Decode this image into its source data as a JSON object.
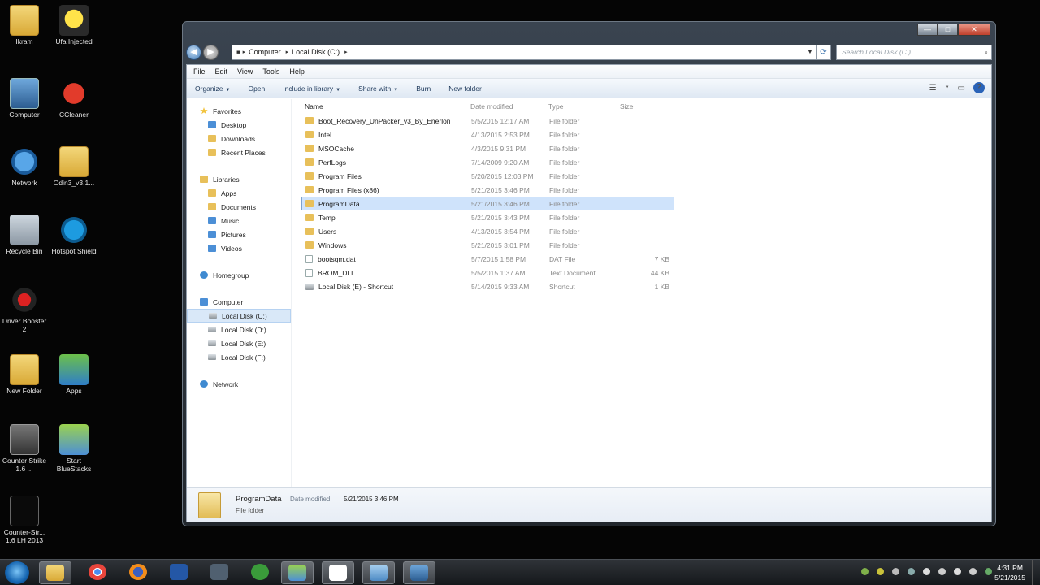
{
  "desktop_icons": [
    {
      "label": "Ikram",
      "x": 0,
      "y": 0
    },
    {
      "label": "Ufa Injected"
    },
    {
      "label": "Computer"
    },
    {
      "label": "CCleaner"
    },
    {
      "label": "Network"
    },
    {
      "label": "Odin3_v3.1..."
    },
    {
      "label": "Recycle Bin"
    },
    {
      "label": "Hotspot Shield"
    },
    {
      "label": "Driver Booster 2"
    },
    {
      "label": "New Folder"
    },
    {
      "label": "Apps"
    },
    {
      "label": "Counter Strike 1.6 ..."
    },
    {
      "label": "Start BlueStacks"
    },
    {
      "label": "Counter-Str... 1.6 LH 2013"
    }
  ],
  "window": {
    "controls": {
      "minimize": "—",
      "maximize": "□",
      "close": "✕"
    },
    "nav": {
      "back": "◀",
      "forward": "▶"
    },
    "breadcrumb": [
      "Computer",
      "Local Disk (C:)"
    ],
    "search_placeholder": "Search Local Disk (C:)",
    "menu": [
      "File",
      "Edit",
      "View",
      "Tools",
      "Help"
    ],
    "toolbar": {
      "organize": "Organize",
      "open": "Open",
      "include": "Include in library",
      "share": "Share with",
      "burn": "Burn",
      "new_folder": "New folder",
      "help": "?"
    },
    "nav_pane": {
      "favorites": "Favorites",
      "fav_items": [
        "Desktop",
        "Downloads",
        "Recent Places"
      ],
      "libraries": "Libraries",
      "lib_items": [
        "Apps",
        "Documents",
        "Music",
        "Pictures",
        "Videos"
      ],
      "homegroup": "Homegroup",
      "computer": "Computer",
      "drives": [
        "Local Disk (C:)",
        "Local Disk (D:)",
        "Local Disk (E:)",
        "Local Disk (F:)"
      ],
      "network": "Network"
    },
    "columns": {
      "name": "Name",
      "date": "Date modified",
      "type": "Type",
      "size": "Size"
    },
    "files": [
      {
        "name": "Boot_Recovery_UnPacker_v3_By_Enerlon",
        "date": "5/5/2015 12:17 AM",
        "type": "File folder",
        "size": ""
      },
      {
        "name": "Intel",
        "date": "4/13/2015 2:53 PM",
        "type": "File folder",
        "size": ""
      },
      {
        "name": "MSOCache",
        "date": "4/3/2015 9:31 PM",
        "type": "File folder",
        "size": ""
      },
      {
        "name": "PerfLogs",
        "date": "7/14/2009 9:20 AM",
        "type": "File folder",
        "size": ""
      },
      {
        "name": "Program Files",
        "date": "5/20/2015 12:03 PM",
        "type": "File folder",
        "size": ""
      },
      {
        "name": "Program Files (x86)",
        "date": "5/21/2015 3:46 PM",
        "type": "File folder",
        "size": ""
      },
      {
        "name": "ProgramData",
        "date": "5/21/2015 3:46 PM",
        "type": "File folder",
        "size": ""
      },
      {
        "name": "Temp",
        "date": "5/21/2015 3:43 PM",
        "type": "File folder",
        "size": ""
      },
      {
        "name": "Users",
        "date": "4/13/2015 3:54 PM",
        "type": "File folder",
        "size": ""
      },
      {
        "name": "Windows",
        "date": "5/21/2015 3:01 PM",
        "type": "File folder",
        "size": ""
      },
      {
        "name": "bootsqm.dat",
        "date": "5/7/2015 1:58 PM",
        "type": "DAT File",
        "size": "7 KB"
      },
      {
        "name": "BROM_DLL",
        "date": "5/5/2015 1:37 AM",
        "type": "Text Document",
        "size": "44 KB"
      },
      {
        "name": "Local Disk (E) - Shortcut",
        "date": "5/14/2015 9:33 AM",
        "type": "Shortcut",
        "size": "1 KB"
      }
    ],
    "details": {
      "name": "ProgramData",
      "modified_label": "Date modified:",
      "modified_value": "5/21/2015 3:46 PM",
      "type": "File folder"
    }
  },
  "taskbar": {
    "time": "4:31 PM",
    "date": "5/21/2015"
  }
}
